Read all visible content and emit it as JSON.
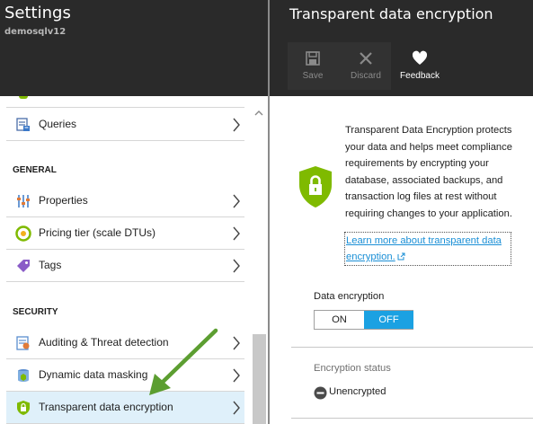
{
  "left_blade": {
    "title": "Settings",
    "subtitle": "demosqlv12",
    "items": [
      {
        "label": "Queries",
        "icon": "queries-icon"
      },
      {
        "label": "Properties",
        "icon": "properties-icon"
      },
      {
        "label": "Pricing tier (scale DTUs)",
        "icon": "pricing-tier-icon"
      },
      {
        "label": "Tags",
        "icon": "tag-icon"
      },
      {
        "label": "Auditing & Threat detection",
        "icon": "auditing-icon"
      },
      {
        "label": "Dynamic data masking",
        "icon": "data-masking-icon"
      },
      {
        "label": "Transparent data encryption",
        "icon": "shield-lock-icon",
        "selected": true
      }
    ],
    "sections": {
      "general": "GENERAL",
      "security": "SECURITY"
    }
  },
  "right_blade": {
    "title": "Transparent data encryption",
    "commands": {
      "save": "Save",
      "discard": "Discard",
      "feedback": "Feedback"
    },
    "description": "Transparent Data Encryption protects your data and helps meet compliance requirements by encrypting your database, associated backups, and transaction log files at rest without requiring changes to your application.",
    "learn_more": "Learn more about transparent data encryption.",
    "data_encryption": {
      "label": "Data encryption",
      "on": "ON",
      "off": "OFF",
      "selected": "OFF"
    },
    "encryption_status": {
      "label": "Encryption status",
      "value": "Unencrypted"
    }
  },
  "colors": {
    "header_bg": "#2a2a2a",
    "accent": "#1ba1e2",
    "selected_row": "#dff0fa",
    "shield_green": "#7fba00",
    "annotation_arrow": "#5c9e31"
  }
}
